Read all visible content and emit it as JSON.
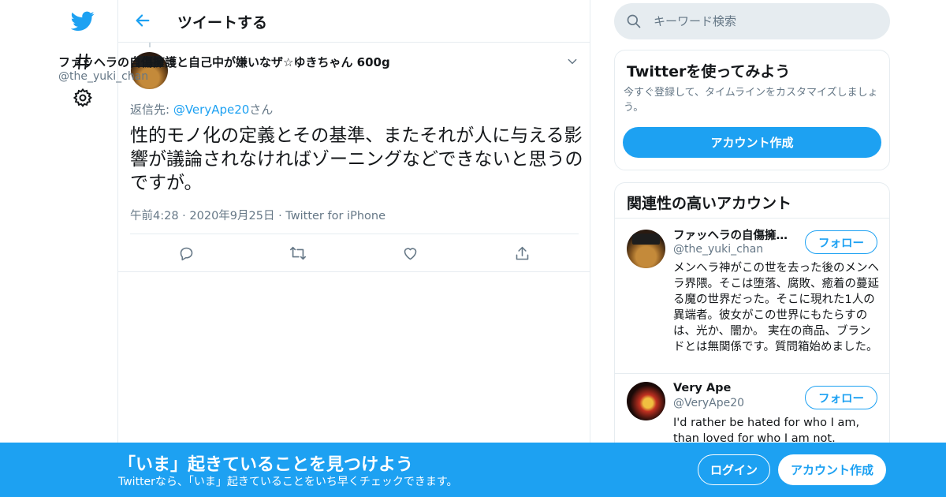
{
  "colors": {
    "brand": "#1da1f2",
    "text": "#14171a",
    "secondary": "#657786",
    "border": "#e6ecf0"
  },
  "nav": {
    "icons": [
      "twitter-bird-icon",
      "hashtag-icon",
      "gear-icon"
    ]
  },
  "header": {
    "title": "ツイートする"
  },
  "tweet": {
    "author_name": "ファッヘラの自傷擁護と自己中が嫌いなザ☆ゆきちゃん 600g",
    "author_handle": "@the_yuki_chan",
    "reply_prefix": "返信先: ",
    "reply_handle": "@VeryApe20",
    "reply_suffix": "さん",
    "text": "性的モノ化の定義とその基準、またそれが人に与える影響が議論されなければゾーニングなどできないと思うのですが。",
    "time": "午前4:28",
    "date": "2020年9月25日",
    "source": "Twitter for iPhone",
    "separator": "·"
  },
  "search": {
    "placeholder": "キーワード検索"
  },
  "try_card": {
    "title": "Twitterを使ってみよう",
    "description": "今すぐ登録して、タイムラインをカスタマイズしましょう。",
    "button": "アカウント作成"
  },
  "related": {
    "title": "関連性の高いアカウント",
    "accounts": [
      {
        "name": "ファッヘラの自傷擁…",
        "handle": "@the_yuki_chan",
        "bio": "メンヘラ神がこの世を去った後のメンヘラ界隈。そこは堕落、腐敗、癒着の蔓延る魔の世界だった。そこに現れた1人の異端者。彼女がこの世界にもたらすのは、光か、闇か。 実在の商品、ブランドとは無関係です。質問箱始めました。",
        "follow": "フォロー"
      },
      {
        "name": "Very Ape",
        "handle": "@VeryApe20",
        "bio": "I'd rather be hated for who I am, than loved for who I am not.",
        "follow": "フォロー"
      }
    ]
  },
  "bottom_bar": {
    "title": "「いま」起きていることを見つけよう",
    "subtitle": "Twitterなら、「いま」起きていることをいち早くチェックできます。",
    "login": "ログイン",
    "signup": "アカウント作成"
  }
}
